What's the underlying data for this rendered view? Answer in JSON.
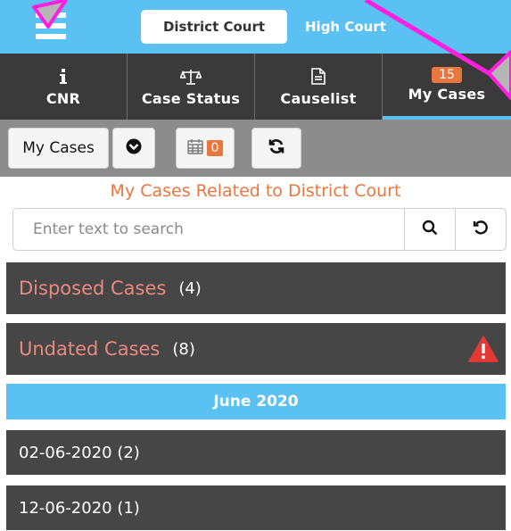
{
  "topbar": {
    "courts": {
      "active": "District Court",
      "inactive": "High Court"
    }
  },
  "tabs": [
    {
      "label": "CNR",
      "icon": "info-icon"
    },
    {
      "label": "Case Status",
      "icon": "scales-icon"
    },
    {
      "label": "Causelist",
      "icon": "document-icon"
    },
    {
      "label": "My Cases",
      "icon": "badge",
      "badge": "15"
    }
  ],
  "toolbar": {
    "mycases_label": "My Cases",
    "calendar_count": "0"
  },
  "heading": "My Cases Related to District Court",
  "search": {
    "placeholder": "Enter text to search"
  },
  "groups": {
    "disposed": {
      "title": "Disposed Cases",
      "count": "(4)"
    },
    "undated": {
      "title": "Undated Cases",
      "count": "(8)"
    }
  },
  "month": "June 2020",
  "dates": [
    {
      "label": "02-06-2020 (2)"
    },
    {
      "label": "12-06-2020 (1)"
    }
  ],
  "colors": {
    "accent_blue": "#5bc0f2",
    "accent_orange": "#e8773f",
    "row_dark": "#464646",
    "annotation_magenta": "#ff1fe0",
    "warning_red": "#e53935"
  }
}
